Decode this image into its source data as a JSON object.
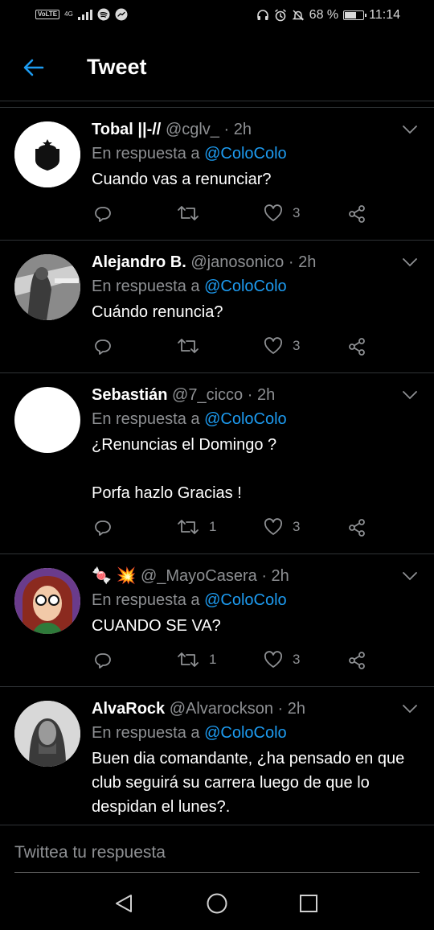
{
  "status_bar": {
    "volte": "VoLTE",
    "network": "4G",
    "battery_percent": "68 %",
    "battery_level": 0.68,
    "time": "11:14",
    "icons": [
      "spotify-icon",
      "messenger-icon",
      "headphones-icon",
      "alarm-icon",
      "mute-icon",
      "battery-icon"
    ]
  },
  "header": {
    "title": "Tweet",
    "back_icon": "arrow-left-icon"
  },
  "colors": {
    "accent": "#1d9bf0",
    "muted": "#8e9093",
    "divider": "#2f3336",
    "background": "#000000"
  },
  "tweets": [
    {
      "name": "Tobal ||-//",
      "handle": "@cglv_",
      "time": "· 2h",
      "reply_label": "En respuesta a",
      "reply_to": "@ColoColo",
      "text": "Cuando vas a renunciar?",
      "retweets": "",
      "likes": "3"
    },
    {
      "name": "Alejandro B.",
      "handle": "@janosonico",
      "time": "· 2h",
      "reply_label": "En respuesta a",
      "reply_to": "@ColoColo",
      "text": "Cuándo renuncia?",
      "retweets": "",
      "likes": "3"
    },
    {
      "name": "Sebastián",
      "handle": "@7_cicco",
      "time": "· 2h",
      "reply_label": "En respuesta a",
      "reply_to": "@ColoColo",
      "text": "¿Renuncias el Domingo ?\n\nPorfa hazlo Gracias !",
      "retweets": "1",
      "likes": "3"
    },
    {
      "name": "🍬 💥",
      "handle": "@_MayoCasera",
      "time": "· 2h",
      "reply_label": "En respuesta a",
      "reply_to": "@ColoColo",
      "text": "CUANDO SE VA?",
      "retweets": "1",
      "likes": "3"
    },
    {
      "name": "AlvaRock",
      "handle": "@Alvarockson",
      "time": "· 2h",
      "reply_label": "En respuesta a",
      "reply_to": "@ColoColo",
      "text": "Buen dia comandante, ¿ha pensado en que club seguirá su carrera luego de que lo despidan el lunes?.",
      "retweets": "",
      "likes": ""
    }
  ],
  "composer": {
    "placeholder": "Twittea tu respuesta"
  },
  "nav": {
    "back": "triangle-back-icon",
    "home": "circle-home-icon",
    "recents": "square-recents-icon"
  }
}
